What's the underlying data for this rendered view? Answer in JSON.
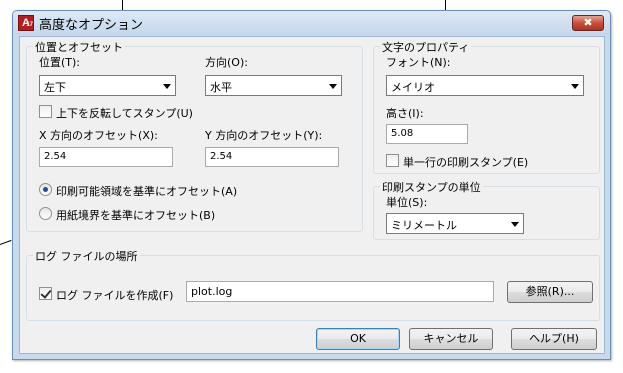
{
  "window": {
    "title": "高度なオプション",
    "icon_letter": "A",
    "icon_sub": "17",
    "close_glyph": "✖"
  },
  "position_group": {
    "label": "位置とオフセット",
    "position_label": "位置(T):",
    "position_value": "左下",
    "direction_label": "方向(O):",
    "direction_value": "水平",
    "flip_label": "上下を反転してスタンプ(U)",
    "flip_checked": false,
    "x_offset_label": "X 方向のオフセット(X):",
    "x_offset_value": "2.54",
    "y_offset_label": "Y 方向のオフセット(Y):",
    "y_offset_value": "2.54",
    "radio_printable_label": "印刷可能領域を基準にオフセット(A)",
    "radio_paper_label": "用紙境界を基準にオフセット(B)",
    "selected_radio": "printable"
  },
  "text_group": {
    "label": "文字のプロパティ",
    "font_label": "フォント(N):",
    "font_value": "メイリオ",
    "height_label": "高さ(I):",
    "height_value": "5.08",
    "single_line_label": "単一行の印刷スタンプ(E)",
    "single_line_checked": false
  },
  "units_group": {
    "label": "印刷スタンプの単位",
    "units_label": "単位(S):",
    "units_value": "ミリメートル"
  },
  "log_group": {
    "label": "ログ ファイルの場所",
    "create_label": "ログ ファイルを作成(F)",
    "create_checked": true,
    "path_value": "plot.log",
    "browse_label": "参照(R)..."
  },
  "buttons": {
    "ok": "OK",
    "cancel": "キャンセル",
    "help": "ヘルプ(H)"
  },
  "colors": {
    "frame": "#c8daee",
    "client": "#f0f0f0",
    "close": "#c8503b",
    "default_button_border": "#3c7fb1"
  }
}
